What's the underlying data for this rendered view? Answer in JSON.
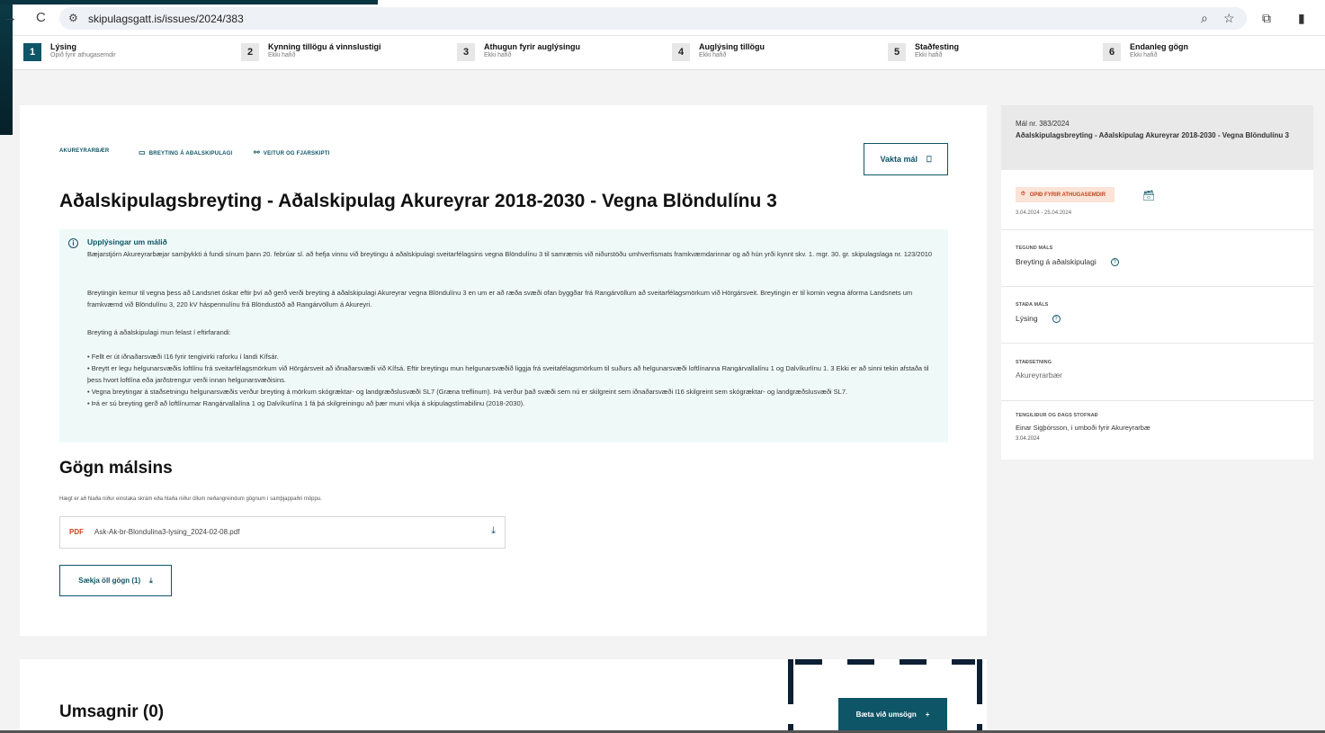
{
  "browser": {
    "url": "skipulagsgatt.is/issues/2024/383"
  },
  "steps": [
    {
      "num": "1",
      "title": "Lýsing",
      "sub": "Opið fyrir athugasemdir"
    },
    {
      "num": "2",
      "title": "Kynning tillögu á vinnslustigi",
      "sub": "Ekki hafið"
    },
    {
      "num": "3",
      "title": "Athugun fyrir auglýsingu",
      "sub": "Ekki hafið"
    },
    {
      "num": "4",
      "title": "Auglýsing tillögu",
      "sub": "Ekki hafið"
    },
    {
      "num": "5",
      "title": "Staðfesting",
      "sub": "Ekki hafið"
    },
    {
      "num": "6",
      "title": "Endanleg gögn",
      "sub": "Ekki hafið"
    }
  ],
  "main": {
    "tags": [
      "AKUREYRARBÆR",
      "BREYTING Á AÐALSKIPULAGI",
      "VEITUR OG FJARSKIPTI"
    ],
    "watch_label": "Vakta mál",
    "title": "Aðalskipulagsbreyting - Aðalskipulag Akureyrar 2018-2030 - Vegna Blöndulínu 3",
    "info_title": "Upplýsingar um málið",
    "info_paragraphs": [
      "Bæjarstjórn Akureyrarbæjar samþykkti á fundi sínum þann 20. febrúar sl. að hefja vinnu við breytingu á aðalskipulagi sveitarfélagsins vegna Blöndulínu 3 til samræmis við niðurstöðu umhverfismats framkvæmdarinnar og að hún yrði kynnt skv. 1. mgr. 30. gr. skipulagslaga nr. 123/2010",
      "Breytingin kemur til vegna þess að Landsnet óskar eftir því að gerð verði breyting á aðalskipulagi Akureyrar vegna Blöndulínu 3 en um er að ræða svæði ofan byggðar frá Rangárvöllum að sveitarfélagsmörkum við Hörgársveit. Breytingin er til komin vegna áforma Landsnets um framkvæmd við Blöndulínu 3, 220 kV háspennulínu frá Blöndustöð að Rangárvöllum á Akureyri.",
      "Breyting á aðalskipulagi mun felast í eftirfarandi:",
      "• Fellt er út iðnaðarsvæði I16 fyrir tengivirki raforku í landi Kífsár.\n• Breytt er legu helgunarsvæðis loftlínu frá sveitarfélagsmörkum við Hörgársveit að iðnaðarsvæði við Kífsá. Eftir breytingu mun helgunarsvæðið liggja frá sveitafélagsmörkum til suðurs að helgunarsvæði loftlínanna Rangárvallalínu 1 og Dalvíkurlínu 1. 3 Ekki er að sinni tekin afstaða til þess hvort loftlína eða jarðstrengur verði innan helgunarsvæðisins.\n• Vegna breytingar á staðsetningu helgunarsvæðis verður breyting á mörkum skógræktar- og landgræðslusvæði SL7 (Græna treflinum). Þá verður það svæði sem nú er skilgreint sem iðnaðarsvæði I16 skilgreint sem skógræktar- og landgræðslusvæði SL7.\n• Þá er sú breyting gerð að loftlínurnar Rangárvallalína 1 og Dalvíkurlína 1 fá þá skilgreiningu að þær muni víkja á skipulagstímabilinu (2018-2030)."
    ],
    "docs_title": "Gögn málsins",
    "docs_hint": "Hægt er að hlaða niður einstaka skrám eða hlaða niður öllum neðangreindum gögnum í samþjappaðri möppu.",
    "file_type": "PDF",
    "file_name": "Ask-Ak-br-Blondulina3-lysing_2024-02-08.pdf",
    "download_all_label": "Sækja öll gögn (1)"
  },
  "side": {
    "case_number": "Mál nr. 383/2024",
    "case_title": "Aðalskipulagsbreyting - Aðalskipulag Akureyrar 2018-2030 - Vegna Blöndulínu 3",
    "badge": "OPIÐ FYRIR ATHUGASEMDIR",
    "dates": "3.04.2024 - 25.04.2024",
    "type_label": "TEGUND MÁLS",
    "type_value": "Breyting á aðalskipulagi",
    "status_label": "STAÐA MÁLS",
    "status_value": "Lýsing",
    "location_label": "STAÐSETNING",
    "location_value": "Akureyrarbær",
    "contact_label": "TENGILIÐUR OG DAGS STOFNAÐ",
    "contact_value": "Einar Sigþórsson, í umboði fyrir Akureyrarbæ",
    "created": "3.04.2024"
  },
  "comments": {
    "title": "Umsagnir (0)",
    "add_label": "Bæta við umsögn"
  },
  "colors": {
    "accent": "#0e5567",
    "badge_bg": "#fbe3d7",
    "badge_text": "#c2461d",
    "info_bg": "#effaf8"
  }
}
